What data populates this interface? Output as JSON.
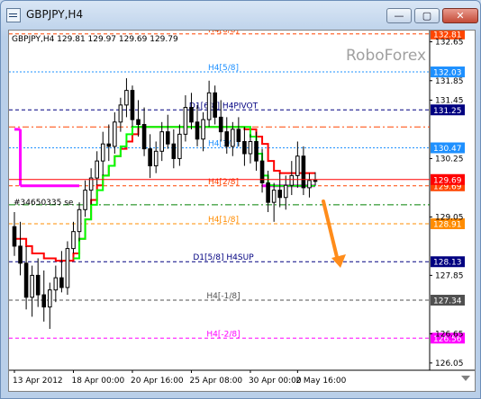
{
  "window": {
    "title": "GBPJPY,H4",
    "buttons": {
      "minimize": "—",
      "maximize": "▢",
      "close": "✕"
    }
  },
  "colors": {
    "background": "#ffffff",
    "candles": "#000000",
    "red_line": "#ff0000",
    "green_line": "#00ff00",
    "magenta_line": "#ff00ff",
    "arrow": "#ff8c1a",
    "watermark": "#a0a0a0"
  },
  "chart_data": {
    "type": "candlestick",
    "symbol_info": "GBPJPY,H4  129.81 129.97 129.69 129.79",
    "watermark": "RoboForex",
    "y_axis": {
      "range": [
        125.9,
        132.88
      ],
      "ticks": [
        "132.65",
        "131.85",
        "131.45",
        "130.25",
        "129.05",
        "127.85",
        "126.65",
        "126.05"
      ]
    },
    "x_axis": {
      "tick_labels": [
        "13 Apr 2012",
        "18 Apr 00:00",
        "20 Apr 16:00",
        "25 Apr 08:00",
        "30 Apr 00:00",
        "2 May 16:00"
      ]
    },
    "levels": [
      {
        "label": "H4[6/8]",
        "value": 132.81,
        "price": "132.81",
        "color": "#ff4500",
        "style": "dash",
        "label_color": "#ff4500"
      },
      {
        "label": "H4[5/8]",
        "value": 132.03,
        "price": "132.03",
        "color": "#1e90ff",
        "style": "dot",
        "label_color": "#1e90ff"
      },
      {
        "label": "D1[6/8] H4PIVOT",
        "value": 131.25,
        "price": "131.25",
        "color": "#000080",
        "style": "dash",
        "label_color": "#000080"
      },
      {
        "label": "H4[3/8]",
        "value": 130.47,
        "price": "130.47",
        "color": "#1e90ff",
        "style": "dot",
        "label_color": "#1e90ff"
      },
      {
        "label": "H4[2/8]",
        "value": 129.69,
        "price": "129.69",
        "color": "#ff4500",
        "style": "dash",
        "label_color": "#ff4500"
      },
      {
        "label": "H4[1/8]",
        "value": 128.91,
        "price": "128.91",
        "color": "#ff8c00",
        "style": "dash",
        "label_color": "#ff8c00"
      },
      {
        "label": "D1[5/8] H4SUP",
        "value": 128.13,
        "price": "128.13",
        "color": "#000080",
        "style": "dash",
        "label_color": "#000080"
      },
      {
        "label": "H4[-1/8]",
        "value": 127.34,
        "price": "127.34",
        "color": "#505050",
        "style": "dash",
        "label_color": "#505050"
      },
      {
        "label": "H4[-2/8]",
        "value": 126.56,
        "price": "126.56",
        "color": "#ff00ff",
        "style": "dash",
        "label_color": "#ff00ff"
      }
    ],
    "extra_levels": [
      {
        "value": 130.9,
        "color": "#ff4500",
        "style": "dashdot"
      },
      {
        "value": 129.3,
        "color": "#008000",
        "style": "dashdot"
      }
    ],
    "order_label": "#34650335 se",
    "current_price": {
      "value": 129.69,
      "label": "129.69"
    },
    "candles": [
      {
        "o": 128.85,
        "h": 129.15,
        "l": 128.25,
        "c": 128.45
      },
      {
        "o": 128.45,
        "h": 128.95,
        "l": 127.85,
        "c": 128.1
      },
      {
        "o": 128.1,
        "h": 128.45,
        "l": 127.15,
        "c": 127.4
      },
      {
        "o": 127.4,
        "h": 128.05,
        "l": 127.0,
        "c": 127.85
      },
      {
        "o": 127.85,
        "h": 128.2,
        "l": 127.2,
        "c": 127.45
      },
      {
        "o": 127.45,
        "h": 127.95,
        "l": 126.9,
        "c": 127.2
      },
      {
        "o": 127.2,
        "h": 127.7,
        "l": 126.75,
        "c": 127.55
      },
      {
        "o": 127.55,
        "h": 128.05,
        "l": 127.3,
        "c": 127.8
      },
      {
        "o": 127.8,
        "h": 128.35,
        "l": 127.5,
        "c": 127.6
      },
      {
        "o": 127.6,
        "h": 128.55,
        "l": 127.45,
        "c": 128.4
      },
      {
        "o": 128.4,
        "h": 128.95,
        "l": 128.3,
        "c": 128.75
      },
      {
        "o": 128.75,
        "h": 129.35,
        "l": 128.55,
        "c": 129.2
      },
      {
        "o": 129.2,
        "h": 129.8,
        "l": 129.05,
        "c": 129.6
      },
      {
        "o": 129.6,
        "h": 130.05,
        "l": 129.3,
        "c": 129.85
      },
      {
        "o": 129.85,
        "h": 130.4,
        "l": 129.7,
        "c": 130.2
      },
      {
        "o": 130.2,
        "h": 130.8,
        "l": 129.9,
        "c": 130.55
      },
      {
        "o": 130.55,
        "h": 130.95,
        "l": 130.2,
        "c": 130.5
      },
      {
        "o": 130.5,
        "h": 131.2,
        "l": 130.35,
        "c": 131.0
      },
      {
        "o": 131.0,
        "h": 131.5,
        "l": 130.8,
        "c": 131.35
      },
      {
        "o": 131.35,
        "h": 131.9,
        "l": 131.1,
        "c": 131.65
      },
      {
        "o": 131.65,
        "h": 131.75,
        "l": 130.9,
        "c": 131.05
      },
      {
        "o": 131.05,
        "h": 131.45,
        "l": 130.7,
        "c": 130.95
      },
      {
        "o": 130.95,
        "h": 131.3,
        "l": 130.3,
        "c": 130.45
      },
      {
        "o": 130.45,
        "h": 130.75,
        "l": 129.85,
        "c": 130.1
      },
      {
        "o": 130.1,
        "h": 130.6,
        "l": 129.95,
        "c": 130.4
      },
      {
        "o": 130.4,
        "h": 131.0,
        "l": 130.2,
        "c": 130.8
      },
      {
        "o": 130.8,
        "h": 131.15,
        "l": 130.45,
        "c": 130.55
      },
      {
        "o": 130.55,
        "h": 130.85,
        "l": 130.05,
        "c": 130.25
      },
      {
        "o": 130.25,
        "h": 130.95,
        "l": 130.1,
        "c": 130.75
      },
      {
        "o": 130.75,
        "h": 131.55,
        "l": 130.6,
        "c": 131.3
      },
      {
        "o": 131.3,
        "h": 131.6,
        "l": 130.85,
        "c": 131.0
      },
      {
        "o": 131.0,
        "h": 131.35,
        "l": 130.5,
        "c": 130.65
      },
      {
        "o": 130.65,
        "h": 131.2,
        "l": 130.4,
        "c": 131.05
      },
      {
        "o": 131.05,
        "h": 131.85,
        "l": 130.9,
        "c": 131.6
      },
      {
        "o": 131.6,
        "h": 131.75,
        "l": 130.95,
        "c": 131.1
      },
      {
        "o": 131.1,
        "h": 131.45,
        "l": 130.6,
        "c": 130.8
      },
      {
        "o": 130.8,
        "h": 131.1,
        "l": 130.35,
        "c": 130.5
      },
      {
        "o": 130.5,
        "h": 131.0,
        "l": 130.3,
        "c": 130.85
      },
      {
        "o": 130.85,
        "h": 131.1,
        "l": 130.5,
        "c": 130.6
      },
      {
        "o": 130.6,
        "h": 130.9,
        "l": 130.1,
        "c": 130.35
      },
      {
        "o": 130.35,
        "h": 130.75,
        "l": 130.15,
        "c": 130.6
      },
      {
        "o": 130.6,
        "h": 130.8,
        "l": 130.0,
        "c": 130.2
      },
      {
        "o": 130.2,
        "h": 130.45,
        "l": 129.55,
        "c": 129.75
      },
      {
        "o": 129.75,
        "h": 130.0,
        "l": 129.15,
        "c": 129.35
      },
      {
        "o": 129.35,
        "h": 129.75,
        "l": 128.95,
        "c": 129.6
      },
      {
        "o": 129.6,
        "h": 129.95,
        "l": 129.25,
        "c": 129.45
      },
      {
        "o": 129.45,
        "h": 129.9,
        "l": 129.2,
        "c": 129.7
      },
      {
        "o": 129.7,
        "h": 130.2,
        "l": 129.5,
        "c": 129.9
      },
      {
        "o": 129.9,
        "h": 130.6,
        "l": 129.65,
        "c": 130.3
      },
      {
        "o": 130.3,
        "h": 130.5,
        "l": 129.5,
        "c": 129.65
      },
      {
        "o": 129.65,
        "h": 129.95,
        "l": 129.45,
        "c": 129.8
      },
      {
        "o": 129.8,
        "h": 129.97,
        "l": 129.69,
        "c": 129.79
      }
    ],
    "indicator_red": [
      128.6,
      128.6,
      128.45,
      128.3,
      128.3,
      128.2,
      128.2,
      128.15,
      128.15,
      128.15,
      128.3,
      128.6,
      129.0,
      129.4,
      129.7,
      129.9,
      130.1,
      130.3,
      130.45,
      130.6,
      130.75,
      130.9,
      130.9,
      130.9,
      130.9,
      130.9,
      130.9,
      130.9,
      130.9,
      130.9,
      130.9,
      130.9,
      130.9,
      130.9,
      130.9,
      130.9,
      130.9,
      130.9,
      130.9,
      130.85,
      130.85,
      130.7,
      130.55,
      130.2,
      130.0,
      129.95,
      129.95,
      129.95,
      129.95,
      129.95,
      129.95,
      129.95
    ],
    "indicator_green": [
      null,
      null,
      null,
      null,
      null,
      null,
      null,
      null,
      null,
      null,
      128.2,
      128.6,
      129.0,
      129.3,
      129.6,
      129.9,
      130.1,
      130.3,
      130.5,
      130.75,
      130.9,
      130.9,
      130.9,
      130.9,
      130.9,
      130.9,
      130.9,
      130.9,
      130.9,
      130.9,
      130.9,
      130.9,
      130.9,
      130.9,
      130.9,
      130.9,
      130.9,
      130.9,
      130.9,
      130.9,
      130.7,
      130.35,
      129.9,
      129.7,
      129.69,
      129.69,
      129.69,
      129.69,
      129.69,
      129.69,
      129.69,
      129.69
    ],
    "magenta_segments": [
      {
        "y": 130.85,
        "from": 0,
        "to": 1
      },
      {
        "y": 129.69,
        "from": 1,
        "to": 11
      },
      {
        "y": 129.69,
        "from": 42,
        "to": 51
      }
    ]
  }
}
